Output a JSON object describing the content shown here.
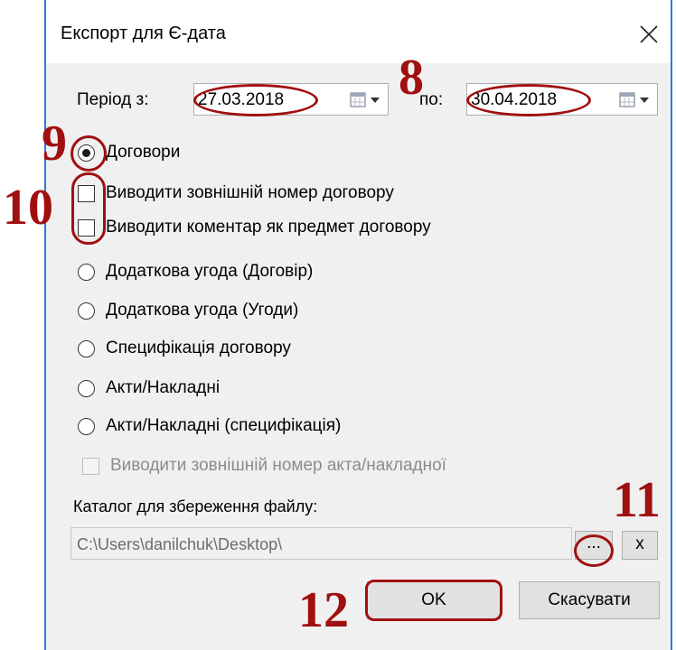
{
  "window": {
    "title": "Експорт для Є-дата"
  },
  "period": {
    "from_label": "Період з:",
    "from_value": "27.03.2018",
    "to_label": "по:",
    "to_value": "30.04.2018"
  },
  "options": {
    "contracts": "Договори",
    "ext_number": "Виводити зовнішній номер договору",
    "comment_subject": "Виводити коментар як предмет договору",
    "addendum_contract": "Додаткова угода (Договір)",
    "addendum_deals": "Додаткова угода (Угоди)",
    "specification": "Специфікація договору",
    "acts": "Акти/Накладні",
    "acts_spec": "Акти/Накладні (специфікація)",
    "act_ext_number": "Виводити зовнішній номер акта/накладної"
  },
  "save": {
    "label": "Каталог для збереження файлу:",
    "path": "C:\\Users\\danilchuk\\Desktop\\",
    "browse_label": "...",
    "clear_label": "x"
  },
  "buttons": {
    "ok": "OK",
    "cancel": "Скасувати"
  },
  "annotations": {
    "n8": "8",
    "n9": "9",
    "n10": "10",
    "n11": "11",
    "n12": "12"
  },
  "colors": {
    "annotation": "#a01010",
    "window_border": "#2b7bd8"
  }
}
